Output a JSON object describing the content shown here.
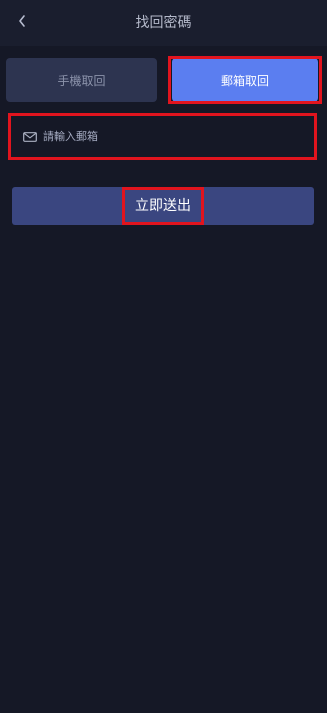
{
  "header": {
    "title": "找回密碼",
    "back_icon": "chevron-left-icon"
  },
  "tabs": [
    {
      "label": "手機取回",
      "active": false
    },
    {
      "label": "郵箱取回",
      "active": true
    }
  ],
  "email": {
    "placeholder": "請輸入郵箱",
    "value": "",
    "icon": "mail-icon"
  },
  "submit": {
    "label": "立即送出"
  },
  "colors": {
    "background": "#151826",
    "header_bg": "#1a1e2e",
    "tab_inactive_bg": "#2d3450",
    "tab_active_bg": "#5b7ef0",
    "button_bg": "#3a4680",
    "highlight": "#e1141e"
  }
}
